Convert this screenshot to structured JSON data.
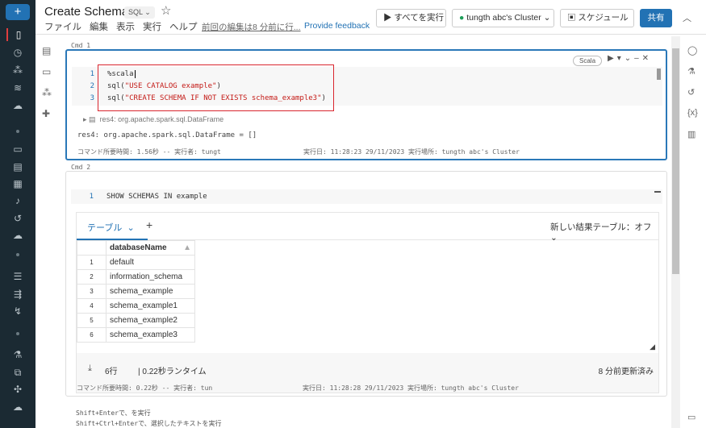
{
  "header": {
    "title": "Create Schema",
    "language": "SQL",
    "menu": [
      "ファイル",
      "編集",
      "表示",
      "実行",
      "ヘルプ"
    ],
    "last_edit": "前回の編集は8 分前に行...",
    "feedback": "Provide feedback",
    "run_all": "すべてを実行",
    "cluster": "tungth abc's Cluster",
    "schedule": "スケジュール",
    "share": "共有",
    "cluster_status_color": "#1e9e5a"
  },
  "cells": [
    {
      "label": "Cmd 1",
      "lang_badge": "Scala",
      "code": [
        "%scala",
        "sql(\"USE CATALOG example\")",
        "sql(\"CREATE SCHEMA IF NOT EXISTS schema_example3\")"
      ],
      "result_summary": "res4:  org.apache.spark.sql.DataFrame",
      "output": "res4: org.apache.spark.sql.DataFrame = []",
      "duration": "コマンド所要時間: 1.56秒 -- 実行者: tungt",
      "executed": "実行日: 11:28:23 29/11/2023 実行場所: tungth abc's Cluster"
    },
    {
      "label": "Cmd 2",
      "code": [
        "SHOW SCHEMAS IN example"
      ],
      "tab": "テーブル",
      "add_tab": "+",
      "new_result_table": "新しい結果テーブル：オフ",
      "table": {
        "column": "databaseName",
        "rows": [
          [
            "1",
            "default"
          ],
          [
            "2",
            "information_schema"
          ],
          [
            "3",
            "schema_example"
          ],
          [
            "4",
            "schema_example1"
          ],
          [
            "5",
            "schema_example2"
          ],
          [
            "6",
            "schema_example3"
          ]
        ]
      },
      "row_count": "6行",
      "runtime": "| 0.22秒ランタイム",
      "updated": "8 分前更新済み",
      "duration": "コマンド所要時間: 0.22秒 -- 実行者: tun",
      "executed": "実行日: 11:28:28 29/11/2023 実行場所: tungth abc's Cluster"
    }
  ],
  "hints": [
    "Shift+Enterで、を実行",
    "Shift+Ctrl+Enterで、選択したテキストを実行"
  ]
}
